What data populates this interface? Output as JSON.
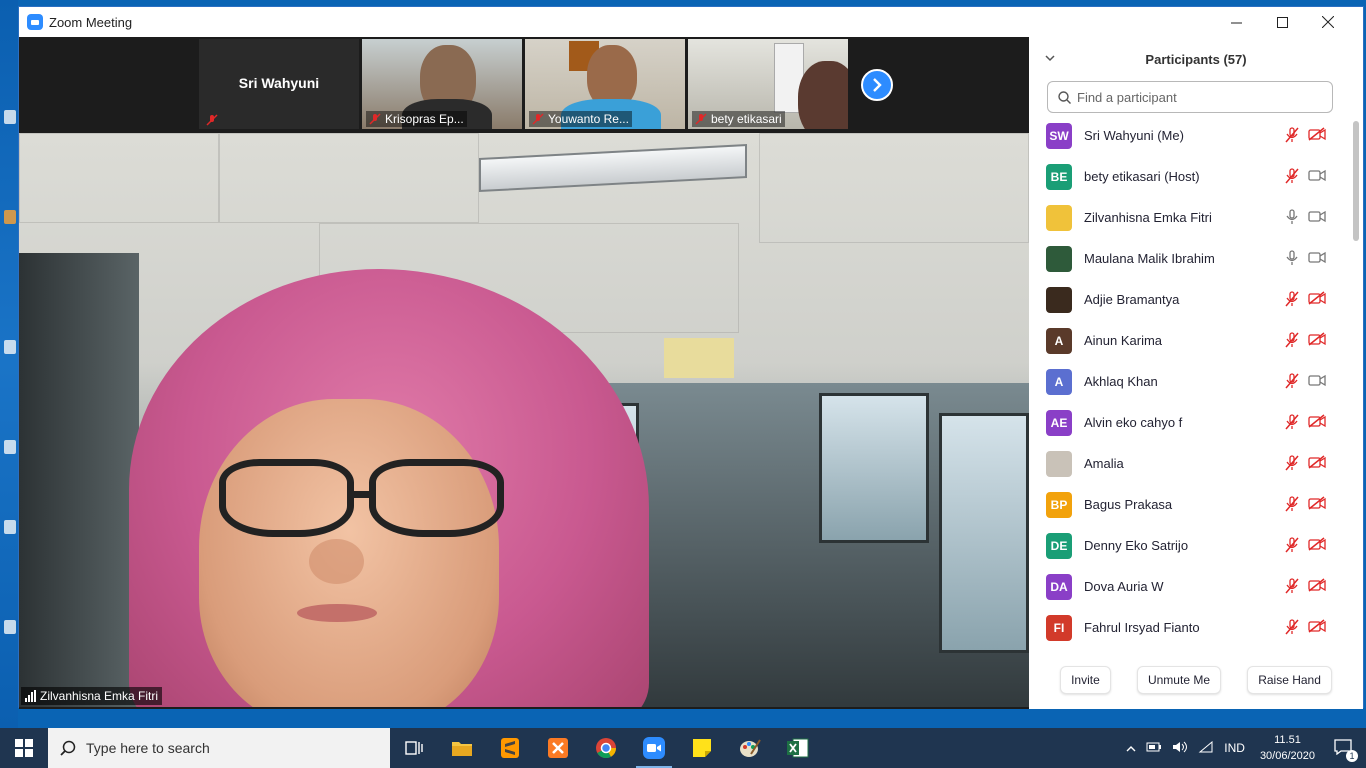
{
  "window": {
    "title": "Zoom Meeting"
  },
  "thumbnails": [
    {
      "name": "Sri Wahyuni",
      "label": ""
    },
    {
      "name": "",
      "label": "Krisopras Ep..."
    },
    {
      "name": "",
      "label": "Youwanto Re..."
    },
    {
      "name": "",
      "label": "bety etikasari"
    }
  ],
  "main_video": {
    "speaker_label": "Zilvanhisna Emka Fitri"
  },
  "participants": {
    "header": "Participants (57)",
    "search_placeholder": "Find a participant",
    "list": [
      {
        "initials": "SW",
        "name": "Sri Wahyuni (Me)",
        "color": "#8a3fc7",
        "mic": "muted",
        "cam": "off"
      },
      {
        "initials": "BE",
        "name": "bety etikasari (Host)",
        "color": "#1a9e76",
        "mic": "muted",
        "cam": "on"
      },
      {
        "initials": "",
        "name": "Zilvanhisna Emka Fitri",
        "color": "#f0c23a",
        "mic": "on",
        "cam": "on"
      },
      {
        "initials": "",
        "name": "Maulana Malik Ibrahim",
        "color": "#2e5a3a",
        "mic": "on",
        "cam": "on"
      },
      {
        "initials": "",
        "name": "Adjie Bramantya",
        "color": "#3a2a1e",
        "mic": "muted",
        "cam": "off"
      },
      {
        "initials": "A",
        "name": "Ainun Karima",
        "color": "#5a3a2a",
        "mic": "muted",
        "cam": "off"
      },
      {
        "initials": "A",
        "name": "Akhlaq Khan",
        "color": "#5b6fd0",
        "mic": "muted",
        "cam": "on"
      },
      {
        "initials": "AE",
        "name": "Alvin eko cahyo f",
        "color": "#8a3fc7",
        "mic": "muted",
        "cam": "off"
      },
      {
        "initials": "",
        "name": "Amalia",
        "color": "#c9c2b8",
        "mic": "muted",
        "cam": "off"
      },
      {
        "initials": "BP",
        "name": "Bagus Prakasa",
        "color": "#f2a20c",
        "mic": "muted",
        "cam": "off"
      },
      {
        "initials": "DE",
        "name": "Denny Eko Satrijo",
        "color": "#1a9e76",
        "mic": "muted",
        "cam": "off"
      },
      {
        "initials": "DA",
        "name": "Dova Auria W",
        "color": "#8a3fc7",
        "mic": "muted",
        "cam": "off"
      },
      {
        "initials": "FI",
        "name": "Fahrul Irsyad Fianto",
        "color": "#d23a2a",
        "mic": "muted",
        "cam": "off"
      }
    ],
    "buttons": {
      "invite": "Invite",
      "unmute": "Unmute Me",
      "raise_hand": "Raise Hand"
    }
  },
  "taskbar": {
    "search_placeholder": "Type here to search",
    "language": "IND",
    "time": "11.51",
    "date": "30/06/2020",
    "notification_count": "1"
  },
  "colors": {
    "zoom_blue": "#2d8cff",
    "muted_red": "#e02828",
    "taskbar": "#1f3550"
  }
}
